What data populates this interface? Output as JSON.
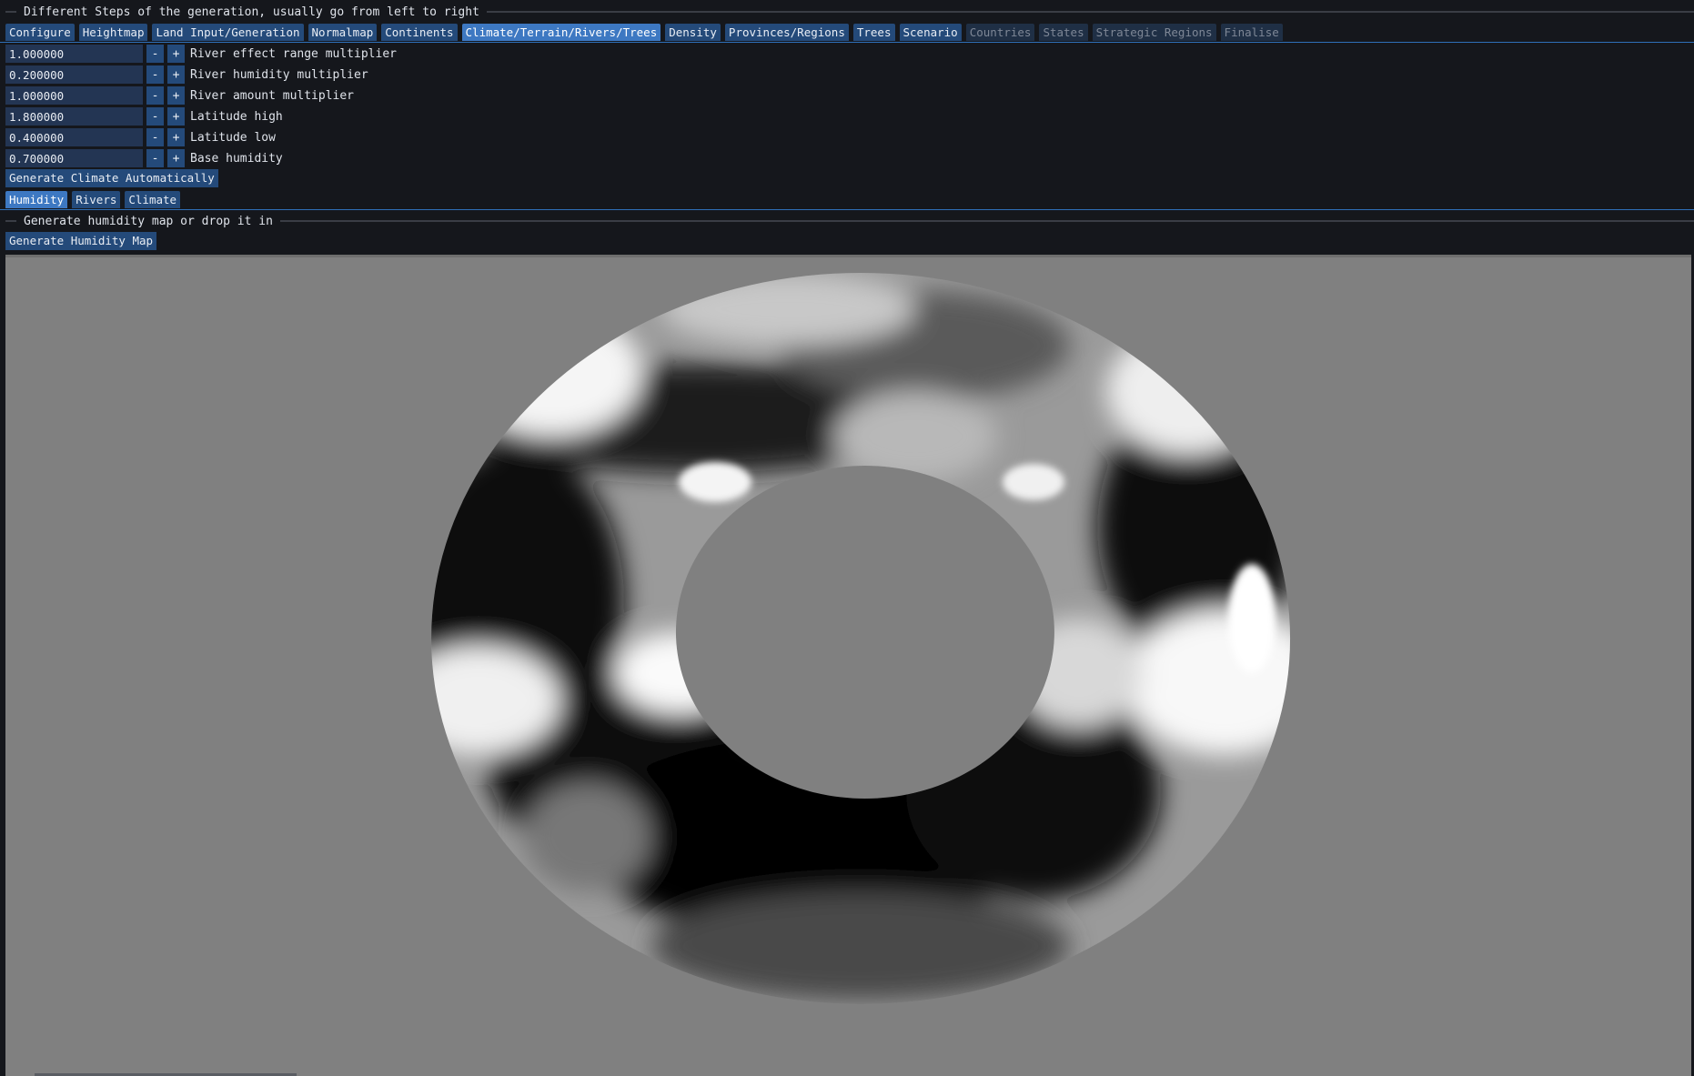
{
  "header": {
    "title": "Different Steps of the generation, usually go from left to right"
  },
  "steps": [
    {
      "label": "Configure",
      "state": "normal"
    },
    {
      "label": "Heightmap",
      "state": "normal"
    },
    {
      "label": "Land Input/Generation",
      "state": "normal"
    },
    {
      "label": "Normalmap",
      "state": "normal"
    },
    {
      "label": "Continents",
      "state": "normal"
    },
    {
      "label": "Climate/Terrain/Rivers/Trees",
      "state": "active"
    },
    {
      "label": "Density",
      "state": "normal"
    },
    {
      "label": "Provinces/Regions",
      "state": "normal"
    },
    {
      "label": "Trees",
      "state": "normal"
    },
    {
      "label": "Scenario",
      "state": "normal"
    },
    {
      "label": "Countries",
      "state": "disabled"
    },
    {
      "label": "States",
      "state": "disabled"
    },
    {
      "label": "Strategic Regions",
      "state": "disabled"
    },
    {
      "label": "Finalise",
      "state": "disabled"
    }
  ],
  "params": [
    {
      "value": "1.000000",
      "label": "River effect range multiplier"
    },
    {
      "value": "0.200000",
      "label": "River humidity multiplier"
    },
    {
      "value": "1.000000",
      "label": "River amount multiplier"
    },
    {
      "value": "1.800000",
      "label": "Latitude high"
    },
    {
      "value": "0.400000",
      "label": "Latitude low"
    },
    {
      "value": "0.700000",
      "label": "Base humidity"
    }
  ],
  "stepper": {
    "minus": "-",
    "plus": "+"
  },
  "generate_climate_button": "Generate Climate Automatically",
  "subtabs": [
    {
      "label": "Humidity",
      "state": "active"
    },
    {
      "label": "Rivers",
      "state": "normal"
    },
    {
      "label": "Climate",
      "state": "normal"
    }
  ],
  "section": {
    "title": "Generate humidity map or drop it in"
  },
  "generate_humidity_button": "Generate Humidity Map",
  "colors": {
    "background": "#15171c",
    "tab": "#244a7a",
    "tab_active": "#3d78c2",
    "tab_disabled": "#1f2f45",
    "image_background": "#808080"
  },
  "icons": {
    "image": "humidity-map-torus"
  }
}
